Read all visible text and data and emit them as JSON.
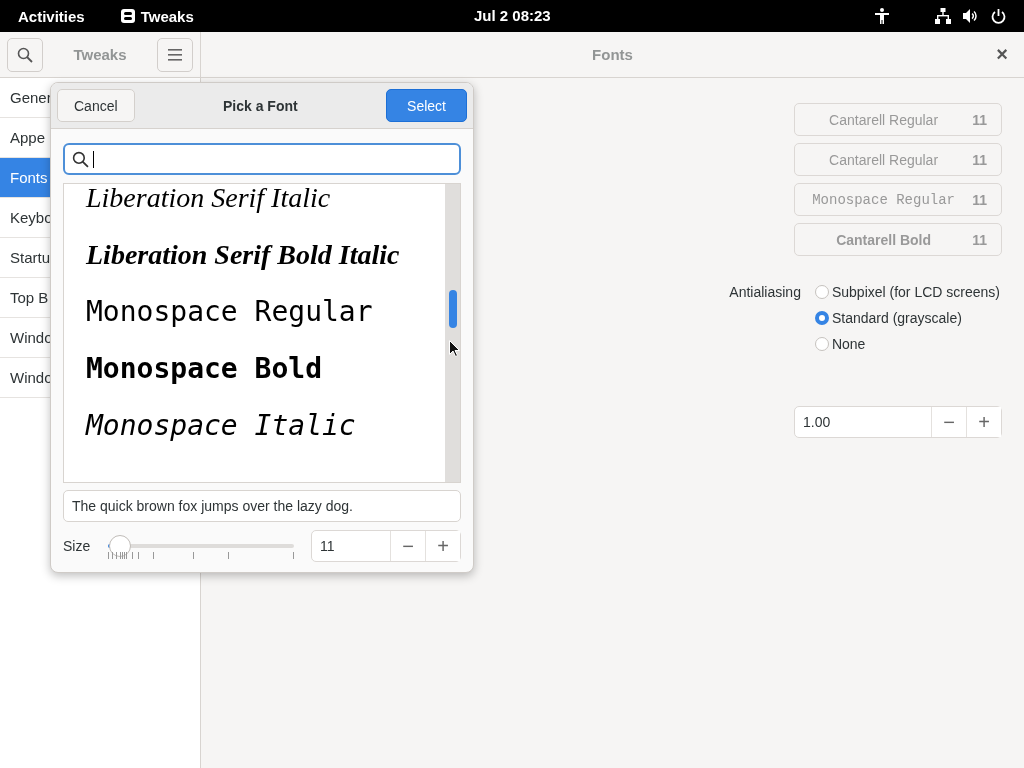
{
  "top_bar": {
    "activities": "Activities",
    "app_name": "Tweaks",
    "clock": "Jul 2  08:23"
  },
  "window": {
    "sidebar_title": "Tweaks",
    "page_title": "Fonts",
    "close": "×"
  },
  "sidebar": {
    "items": [
      {
        "label": "Gener",
        "selected": false
      },
      {
        "label": "Appe",
        "selected": false
      },
      {
        "label": "Fonts",
        "selected": true
      },
      {
        "label": "Keybo",
        "selected": false
      },
      {
        "label": "Startu",
        "selected": false
      },
      {
        "label": "Top B",
        "selected": false
      },
      {
        "label": "Windo",
        "selected": false
      },
      {
        "label": "Windo",
        "selected": false
      }
    ]
  },
  "fonts": {
    "buttons": [
      {
        "kind": "sans",
        "name": "Cantarell Regular",
        "size": "11"
      },
      {
        "kind": "sans",
        "name": "Cantarell Regular",
        "size": "11"
      },
      {
        "kind": "mono",
        "name": "Monospace Regular",
        "size": "11"
      },
      {
        "kind": "bold",
        "name": "Cantarell Bold",
        "size": "11"
      }
    ],
    "antialiasing": {
      "label": "Antialiasing",
      "options": [
        {
          "label": "Subpixel (for LCD screens)",
          "selected": false
        },
        {
          "label": "Standard (grayscale)",
          "selected": true
        },
        {
          "label": "None",
          "selected": false
        }
      ]
    },
    "scaling": {
      "value": "1.00",
      "minus": "−",
      "plus": "+"
    }
  },
  "dialog": {
    "cancel": "Cancel",
    "title": "Pick a Font",
    "select": "Select",
    "font_list": [
      {
        "kind": "serif-italic",
        "name": "Liberation Serif Italic"
      },
      {
        "kind": "serif-bold-italic",
        "name": "Liberation Serif Bold Italic"
      },
      {
        "kind": "mono-regular",
        "name": "Monospace Regular"
      },
      {
        "kind": "mono-bold",
        "name": "Monospace Bold"
      },
      {
        "kind": "mono-italic",
        "name": "Monospace Italic"
      }
    ],
    "preview": "The quick brown fox jumps over the lazy dog.",
    "size_label": "Size",
    "size_slider": {
      "level": 0.03
    },
    "size_value": "11",
    "minus": "−",
    "plus": "+"
  }
}
